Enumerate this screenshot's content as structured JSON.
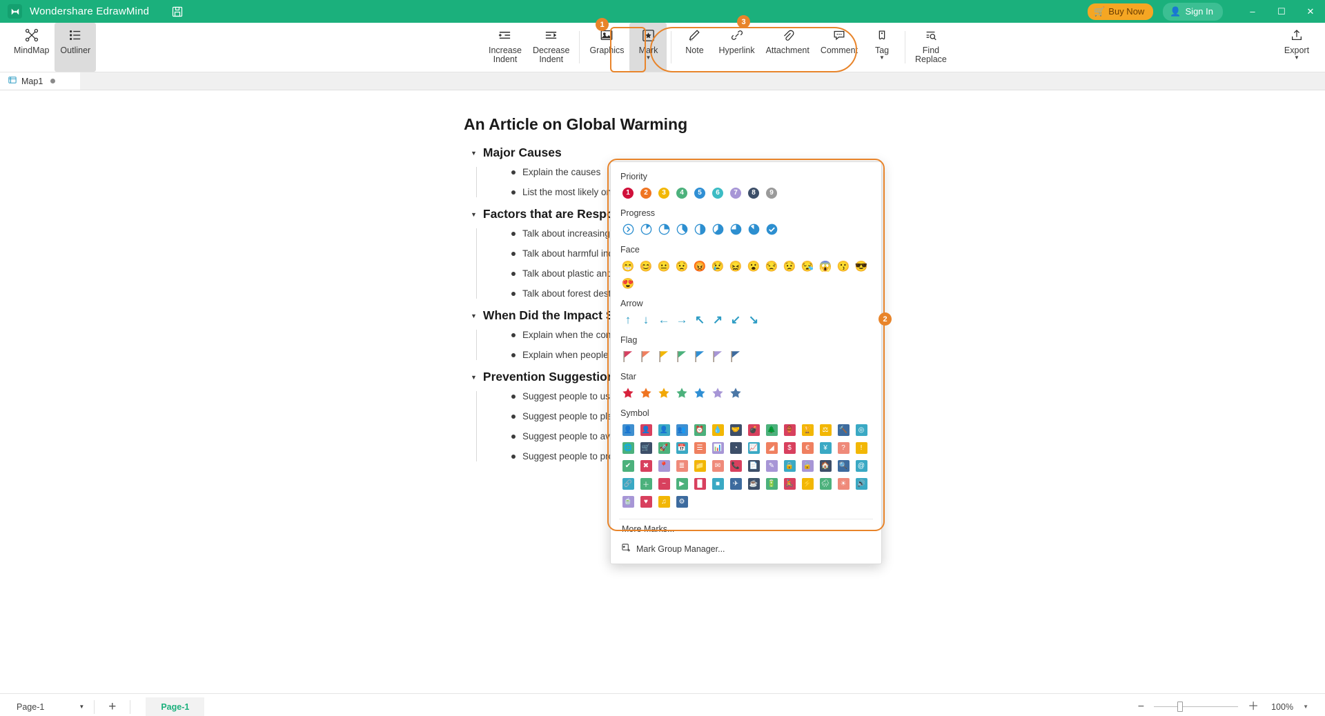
{
  "titlebar": {
    "app_title": "Wondershare EdrawMind",
    "logo_icon": "edrawmind-logo-icon",
    "save_icon": "save-icon",
    "buy_now": "Buy Now",
    "buy_now_icon": "cart-icon",
    "sign_in": "Sign In",
    "sign_in_icon": "user-icon",
    "minimize": "–",
    "maximize": "☐",
    "close": "✕",
    "bg_color": "#1bb07c",
    "buy_now_color": "#f5a623"
  },
  "ribbon": {
    "view_buttons": [
      {
        "label": "MindMap",
        "icon": "mindmap-icon",
        "active": false
      },
      {
        "label": "Outliner",
        "icon": "outliner-icon",
        "active": true
      }
    ],
    "center_buttons": [
      {
        "label": "Increase\nIndent",
        "icon": "increase-indent-icon",
        "caret": false,
        "active": false
      },
      {
        "label": "Decrease\nIndent",
        "icon": "decrease-indent-icon",
        "caret": false,
        "active": false
      },
      {
        "label": "Graphics",
        "icon": "image-icon",
        "caret": false,
        "active": false
      },
      {
        "label": "Mark",
        "icon": "mark-icon",
        "caret": true,
        "active": true
      },
      {
        "label": "Note",
        "icon": "note-pencil-icon",
        "caret": false,
        "active": false
      },
      {
        "label": "Hyperlink",
        "icon": "hyperlink-icon",
        "caret": false,
        "active": false
      },
      {
        "label": "Attachment",
        "icon": "paperclip-icon",
        "caret": false,
        "active": false
      },
      {
        "label": "Comment",
        "icon": "comment-icon",
        "caret": false,
        "active": false
      },
      {
        "label": "Tag",
        "icon": "tag-icon",
        "caret": true,
        "active": false
      },
      {
        "label": "Find\nReplace",
        "icon": "find-replace-icon",
        "caret": false,
        "active": false
      }
    ],
    "export": {
      "label": "Export",
      "icon": "export-icon",
      "caret": true
    }
  },
  "annotations": {
    "badge_1": "1",
    "badge_2": "2",
    "badge_3": "3",
    "highlight_color": "#e8842a"
  },
  "doc_tabs": [
    {
      "label": "Map1",
      "icon": "document-icon",
      "modified": true
    }
  ],
  "outline": {
    "title": "An Article on Global Warming",
    "sections": [
      {
        "heading": "Major Causes",
        "items": [
          "Explain the causes",
          "List the most likely ones"
        ]
      },
      {
        "heading": "Factors that are Responsible",
        "items": [
          "Talk about increasing population",
          "Talk about harmful industries",
          "Talk about plastic and chemicals",
          "Talk about forest destruction"
        ]
      },
      {
        "heading": "When Did the Impact Start",
        "items": [
          "Explain when the concept began",
          "Explain when people started noticing"
        ]
      },
      {
        "heading": "Prevention Suggestions",
        "items": [
          "Suggest people to use less plastic",
          "Suggest people to plant trees",
          "Suggest people to avoid pollution",
          "Suggest people to protect forests"
        ]
      }
    ]
  },
  "mark_menu": {
    "sections": [
      {
        "label": "Priority",
        "type": "priority",
        "items": [
          {
            "name": "priority-1",
            "text": "1",
            "color": "#d0103a"
          },
          {
            "name": "priority-2",
            "text": "2",
            "color": "#ef7522"
          },
          {
            "name": "priority-3",
            "text": "3",
            "color": "#f2b705"
          },
          {
            "name": "priority-4",
            "text": "4",
            "color": "#4cb17c"
          },
          {
            "name": "priority-5",
            "text": "5",
            "color": "#2f8fd4"
          },
          {
            "name": "priority-6",
            "text": "6",
            "color": "#3cbcc4"
          },
          {
            "name": "priority-7",
            "text": "7",
            "color": "#a796d6"
          },
          {
            "name": "priority-8",
            "text": "8",
            "color": "#3d4f69"
          },
          {
            "name": "priority-9",
            "text": "9",
            "color": "#9a9a9a"
          }
        ]
      },
      {
        "label": "Progress",
        "type": "progress",
        "color": "#2d8fd0",
        "items": [
          {
            "name": "progress-start",
            "pct": -1
          },
          {
            "name": "progress-1-8",
            "pct": 12.5
          },
          {
            "name": "progress-1-4",
            "pct": 25
          },
          {
            "name": "progress-3-8",
            "pct": 37.5
          },
          {
            "name": "progress-1-2",
            "pct": 50
          },
          {
            "name": "progress-5-8",
            "pct": 62.5
          },
          {
            "name": "progress-3-4",
            "pct": 75
          },
          {
            "name": "progress-7-8",
            "pct": 87.5
          },
          {
            "name": "progress-done",
            "pct": 100
          }
        ]
      },
      {
        "label": "Face",
        "type": "face",
        "items": [
          {
            "name": "face-grin",
            "glyph": "😁"
          },
          {
            "name": "face-smile",
            "glyph": "😊"
          },
          {
            "name": "face-neutral",
            "glyph": "😐"
          },
          {
            "name": "face-sad",
            "glyph": "😟"
          },
          {
            "name": "face-angry",
            "glyph": "😡"
          },
          {
            "name": "face-cry",
            "glyph": "😢"
          },
          {
            "name": "face-confounded",
            "glyph": "😖"
          },
          {
            "name": "face-surprised",
            "glyph": "😮"
          },
          {
            "name": "face-unamused",
            "glyph": "😒"
          },
          {
            "name": "face-worried",
            "glyph": "😟"
          },
          {
            "name": "face-sleepy",
            "glyph": "😪"
          },
          {
            "name": "face-scream",
            "glyph": "😱"
          },
          {
            "name": "face-kiss",
            "glyph": "😗"
          },
          {
            "name": "face-sunglasses",
            "glyph": "😎"
          },
          {
            "name": "face-heart-eyes",
            "glyph": "😍"
          }
        ]
      },
      {
        "label": "Arrow",
        "type": "arrow",
        "color": "#2d9cc4",
        "items": [
          {
            "name": "arrow-up",
            "glyph": "↑"
          },
          {
            "name": "arrow-down",
            "glyph": "↓"
          },
          {
            "name": "arrow-left",
            "glyph": "←"
          },
          {
            "name": "arrow-right",
            "glyph": "→"
          },
          {
            "name": "arrow-up-left",
            "glyph": "↖"
          },
          {
            "name": "arrow-up-right",
            "glyph": "↗"
          },
          {
            "name": "arrow-down-left",
            "glyph": "↙"
          },
          {
            "name": "arrow-down-right",
            "glyph": "↘"
          }
        ]
      },
      {
        "label": "Flag",
        "type": "flag",
        "items": [
          {
            "name": "flag-red",
            "color": "#d64060"
          },
          {
            "name": "flag-orange",
            "color": "#ef8060"
          },
          {
            "name": "flag-yellow",
            "color": "#f2b705"
          },
          {
            "name": "flag-green",
            "color": "#4cb17c"
          },
          {
            "name": "flag-blue",
            "color": "#2f8fd4"
          },
          {
            "name": "flag-purple",
            "color": "#a796d6"
          },
          {
            "name": "flag-navy",
            "color": "#3d6b9e"
          }
        ]
      },
      {
        "label": "Star",
        "type": "star",
        "items": [
          {
            "name": "star-red",
            "color": "#d8223c"
          },
          {
            "name": "star-orange",
            "color": "#ef7522"
          },
          {
            "name": "star-yellow",
            "color": "#f2a705"
          },
          {
            "name": "star-green",
            "color": "#4cb17c"
          },
          {
            "name": "star-blue",
            "color": "#2f8fd4"
          },
          {
            "name": "star-purple",
            "color": "#a796d6"
          },
          {
            "name": "star-navy",
            "color": "#4b77a6"
          }
        ]
      },
      {
        "label": "Symbol",
        "type": "symbol",
        "items": [
          {
            "name": "symbol-person-blue",
            "color": "#3f8fd0",
            "glyph": "👤"
          },
          {
            "name": "symbol-person-red",
            "color": "#d8405e",
            "glyph": "👤"
          },
          {
            "name": "symbol-person-teal",
            "color": "#3aa9c4",
            "glyph": "👤"
          },
          {
            "name": "symbol-group",
            "color": "#3f8fd0",
            "glyph": "👥"
          },
          {
            "name": "symbol-alarm",
            "color": "#4cb17c",
            "glyph": "⏰"
          },
          {
            "name": "symbol-drop",
            "color": "#f2b705",
            "glyph": "💧"
          },
          {
            "name": "symbol-handshake",
            "color": "#3d4f69",
            "glyph": "🤝"
          },
          {
            "name": "symbol-bomb",
            "color": "#d8405e",
            "glyph": "💣"
          },
          {
            "name": "symbol-tree",
            "color": "#4cb17c",
            "glyph": "🌲"
          },
          {
            "name": "symbol-jug",
            "color": "#d8405e",
            "glyph": "🏺"
          },
          {
            "name": "symbol-trophy",
            "color": "#f2b705",
            "glyph": "🏆"
          },
          {
            "name": "symbol-scale",
            "color": "#f2b705",
            "glyph": "⚖"
          },
          {
            "name": "symbol-gavel",
            "color": "#3d6b9e",
            "glyph": "🔨"
          },
          {
            "name": "symbol-target",
            "color": "#3aa9c4",
            "glyph": "◎"
          },
          {
            "name": "symbol-globe",
            "color": "#4cb17c",
            "glyph": "🌐"
          },
          {
            "name": "symbol-cart",
            "color": "#3d4f69",
            "glyph": "🛒"
          },
          {
            "name": "symbol-rocket",
            "color": "#4cb17c",
            "glyph": "🚀"
          },
          {
            "name": "symbol-calendar",
            "color": "#3aa9c4",
            "glyph": "📅"
          },
          {
            "name": "symbol-list",
            "color": "#ef8060",
            "glyph": "☰"
          },
          {
            "name": "symbol-bar-chart",
            "color": "#a796d6",
            "glyph": "📊"
          },
          {
            "name": "symbol-pie-chart",
            "color": "#3d4f69",
            "glyph": "◔"
          },
          {
            "name": "symbol-line-chart",
            "color": "#3aa9c4",
            "glyph": "📈"
          },
          {
            "name": "symbol-area-chart",
            "color": "#ef8060",
            "glyph": "◢"
          },
          {
            "name": "symbol-dollar",
            "color": "#d8405e",
            "glyph": "$"
          },
          {
            "name": "symbol-euro",
            "color": "#ef8060",
            "glyph": "€"
          },
          {
            "name": "symbol-yen",
            "color": "#3aa9c4",
            "glyph": "¥"
          },
          {
            "name": "symbol-question",
            "color": "#ef8a7a",
            "glyph": "?"
          },
          {
            "name": "symbol-exclaim",
            "color": "#f2b705",
            "glyph": "!"
          },
          {
            "name": "symbol-check",
            "color": "#4cb17c",
            "glyph": "✔"
          },
          {
            "name": "symbol-cross",
            "color": "#d8405e",
            "glyph": "✖"
          },
          {
            "name": "symbol-pin",
            "color": "#a796d6",
            "glyph": "📍"
          },
          {
            "name": "symbol-layers",
            "color": "#ef8a7a",
            "glyph": "≣"
          },
          {
            "name": "symbol-folder",
            "color": "#f2b705",
            "glyph": "📁"
          },
          {
            "name": "symbol-envelope",
            "color": "#ef8a7a",
            "glyph": "✉"
          },
          {
            "name": "symbol-phone",
            "color": "#d8405e",
            "glyph": "📞"
          },
          {
            "name": "symbol-document",
            "color": "#3d4f69",
            "glyph": "📄"
          },
          {
            "name": "symbol-pencil",
            "color": "#a796d6",
            "glyph": "✎"
          },
          {
            "name": "symbol-lock",
            "color": "#3aa9c4",
            "glyph": "🔒"
          },
          {
            "name": "symbol-unlock",
            "color": "#a796d6",
            "glyph": "🔓"
          },
          {
            "name": "symbol-home",
            "color": "#3d4f69",
            "glyph": "🏠"
          },
          {
            "name": "symbol-search",
            "color": "#3d6b9e",
            "glyph": "🔍"
          },
          {
            "name": "symbol-at",
            "color": "#3aa9c4",
            "glyph": "@"
          },
          {
            "name": "symbol-link",
            "color": "#3aa9c4",
            "glyph": "🔗"
          },
          {
            "name": "symbol-plus",
            "color": "#4cb17c",
            "glyph": "＋"
          },
          {
            "name": "symbol-minus",
            "color": "#d8405e",
            "glyph": "−"
          },
          {
            "name": "symbol-play",
            "color": "#4cb17c",
            "glyph": "▶"
          },
          {
            "name": "symbol-pause",
            "color": "#d8405e",
            "glyph": "▐▌"
          },
          {
            "name": "symbol-stop",
            "color": "#3aa9c4",
            "glyph": "■"
          },
          {
            "name": "symbol-plane",
            "color": "#3d6b9e",
            "glyph": "✈"
          },
          {
            "name": "symbol-coffee",
            "color": "#3d4f69",
            "glyph": "☕"
          },
          {
            "name": "symbol-battery",
            "color": "#4cb17c",
            "glyph": "🔋"
          },
          {
            "name": "symbol-bike",
            "color": "#d8405e",
            "glyph": "🚴"
          },
          {
            "name": "symbol-bolt",
            "color": "#f2b705",
            "glyph": "⚡"
          },
          {
            "name": "symbol-rain",
            "color": "#4cb17c",
            "glyph": "🌧"
          },
          {
            "name": "symbol-sun",
            "color": "#ef8a7a",
            "glyph": "☀"
          },
          {
            "name": "symbol-speaker",
            "color": "#3aa9c4",
            "glyph": "🔊"
          },
          {
            "name": "symbol-cup",
            "color": "#a796d6",
            "glyph": "🍵"
          },
          {
            "name": "symbol-heart",
            "color": "#d8405e",
            "glyph": "♥"
          },
          {
            "name": "symbol-music",
            "color": "#f2b705",
            "glyph": "♫"
          },
          {
            "name": "symbol-gear",
            "color": "#3d6b9e",
            "glyph": "⚙"
          }
        ]
      }
    ],
    "more_marks": "More Marks...",
    "mark_group_manager": "Mark Group Manager...",
    "mark_group_manager_icon": "mark-group-icon"
  },
  "statusbar": {
    "page_select": "Page-1",
    "add_page_icon": "plus-icon",
    "page_tab": "Page-1",
    "zoom_minus": "−",
    "zoom_plus": "＋",
    "zoom_value": "100%"
  }
}
